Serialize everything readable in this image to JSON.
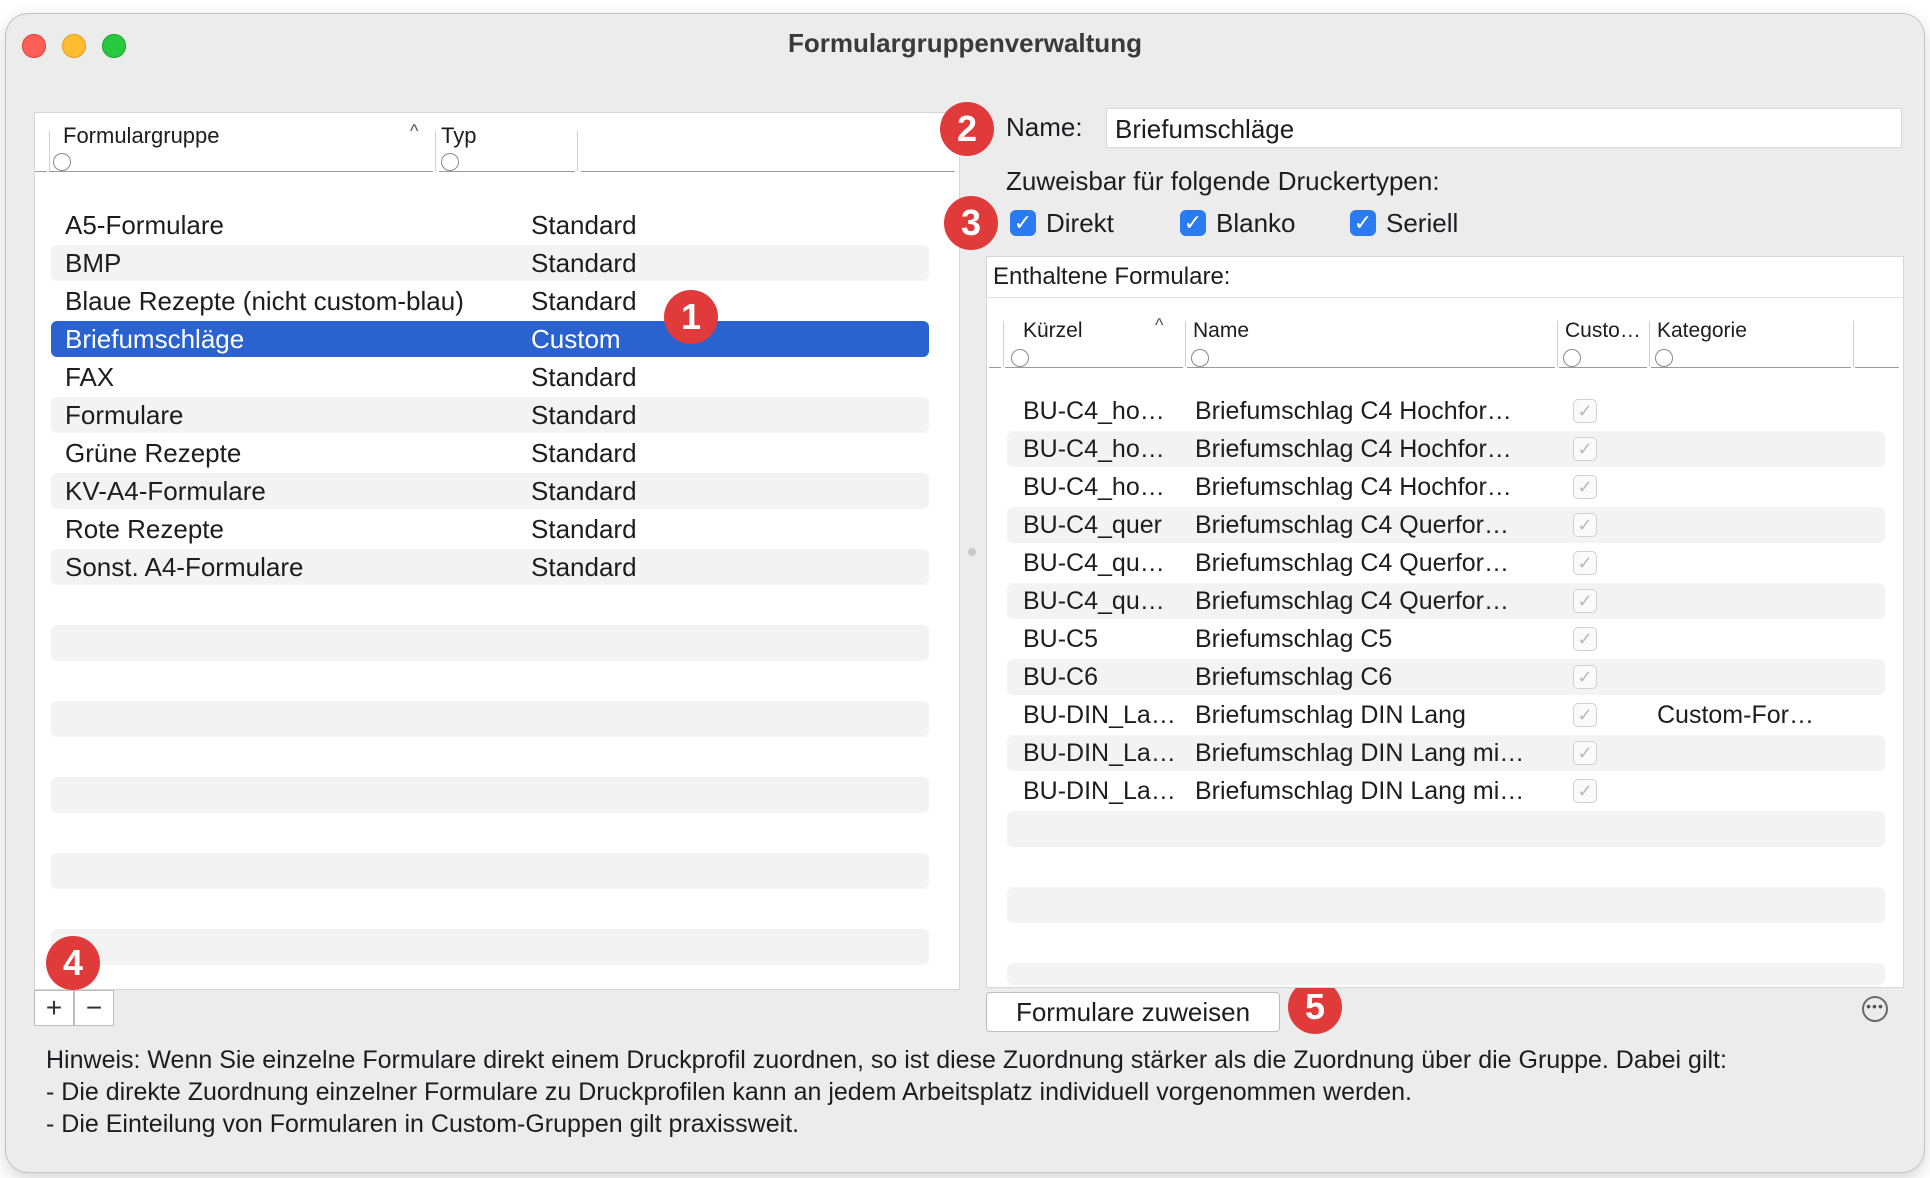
{
  "window": {
    "title": "Formulargruppenverwaltung"
  },
  "groups_table": {
    "columns": {
      "group": "Formulargruppe",
      "type": "Typ"
    },
    "rows": [
      {
        "name": "A5-Formulare",
        "type": "Standard"
      },
      {
        "name": "BMP",
        "type": "Standard"
      },
      {
        "name": "Blaue Rezepte (nicht custom-blau)",
        "type": "Standard"
      },
      {
        "name": "Briefumschläge",
        "type": "Custom"
      },
      {
        "name": "FAX",
        "type": "Standard"
      },
      {
        "name": "Formulare",
        "type": "Standard"
      },
      {
        "name": "Grüne Rezepte",
        "type": "Standard"
      },
      {
        "name": "KV-A4-Formulare",
        "type": "Standard"
      },
      {
        "name": "Rote Rezepte",
        "type": "Standard"
      },
      {
        "name": "Sonst. A4-Formulare",
        "type": "Standard"
      }
    ],
    "selected_index": 3,
    "add_label": "+",
    "remove_label": "−"
  },
  "detail": {
    "name_label": "Name:",
    "name_value": "Briefumschläge",
    "printer_types_label": "Zuweisbar für folgende Druckertypen:",
    "printer_types": [
      {
        "label": "Direkt",
        "checked": true
      },
      {
        "label": "Blanko",
        "checked": true
      },
      {
        "label": "Seriell",
        "checked": true
      }
    ]
  },
  "forms_table": {
    "title": "Enthaltene Formulare:",
    "columns": {
      "short": "Kürzel",
      "name": "Name",
      "custom": "Custo…",
      "category": "Kategorie"
    },
    "rows": [
      {
        "short": "BU-C4_ho…",
        "name": "Briefumschlag C4 Hochfor…",
        "category": ""
      },
      {
        "short": "BU-C4_ho…",
        "name": "Briefumschlag C4 Hochfor…",
        "category": ""
      },
      {
        "short": "BU-C4_ho…",
        "name": "Briefumschlag C4 Hochfor…",
        "category": ""
      },
      {
        "short": "BU-C4_quer",
        "name": "Briefumschlag C4 Querfor…",
        "category": ""
      },
      {
        "short": "BU-C4_qu…",
        "name": "Briefumschlag C4 Querfor…",
        "category": ""
      },
      {
        "short": "BU-C4_qu…",
        "name": "Briefumschlag C4 Querfor…",
        "category": ""
      },
      {
        "short": "BU-C5",
        "name": "Briefumschlag C5",
        "category": ""
      },
      {
        "short": "BU-C6",
        "name": "Briefumschlag C6",
        "category": ""
      },
      {
        "short": "BU-DIN_La…",
        "name": "Briefumschlag DIN Lang",
        "category": "Custom-For…"
      },
      {
        "short": "BU-DIN_La…",
        "name": "Briefumschlag DIN Lang mi…",
        "category": ""
      },
      {
        "short": "BU-DIN_La…",
        "name": "Briefumschlag DIN Lang mi…",
        "category": ""
      }
    ],
    "assign_button": "Formulare zuweisen"
  },
  "badges": [
    "1",
    "2",
    "3",
    "4",
    "5"
  ],
  "hint": {
    "line1": "Hinweis: Wenn Sie einzelne Formulare direkt einem Druckprofil zuordnen, so ist diese Zuordnung stärker als die Zuordnung über die Gruppe. Dabei gilt:",
    "line2": "- Die direkte Zuordnung einzelner Formulare zu Druckprofilen kann an jedem Arbeitsplatz individuell vorgenommen werden.",
    "line3": "- Die Einteilung von Formularen in Custom-Gruppen gilt praxissweit."
  },
  "colors": {
    "selection": "#2a62cf",
    "checkbox": "#2a7bf0",
    "badge": "#e03a3a"
  },
  "icons": {
    "sort": "chevron-up-icon",
    "more": "ellipsis-circle-icon"
  }
}
